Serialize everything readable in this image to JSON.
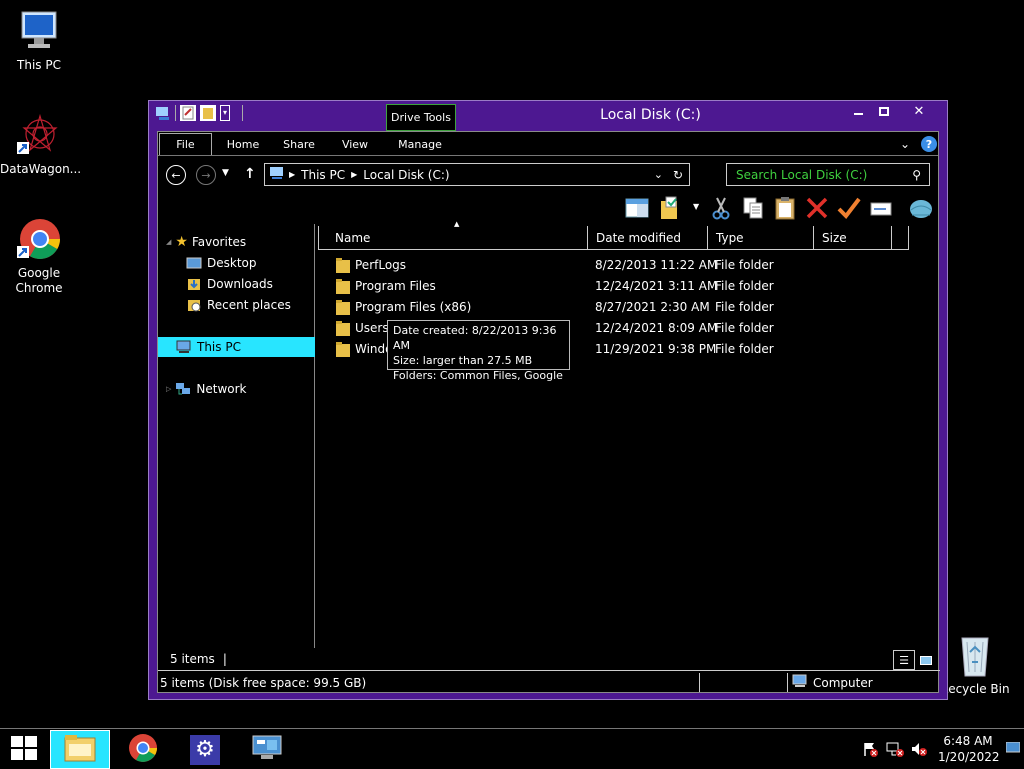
{
  "desktop": {
    "icons": [
      {
        "label": "This PC",
        "icon": "computer-icon"
      },
      {
        "label": "DataWagon...",
        "icon": "datawagon-icon"
      },
      {
        "label": "Google\nChrome",
        "icon": "chrome-icon"
      },
      {
        "label": "Recycle Bin",
        "icon": "recycle-bin-icon"
      }
    ]
  },
  "window": {
    "title": "Local Disk (C:)",
    "contextual_tab": "Drive Tools",
    "ribbon_tabs": [
      "File",
      "Home",
      "Share",
      "View",
      "Manage"
    ],
    "address": {
      "segments": [
        "This PC",
        "Local Disk (C:)"
      ]
    },
    "search_placeholder": "Search Local Disk (C:)",
    "nav": {
      "favorites": "Favorites",
      "desktop": "Desktop",
      "downloads": "Downloads",
      "recent": "Recent places",
      "thispc": "This PC",
      "network": "Network"
    },
    "columns": [
      "Name",
      "Date modified",
      "Type",
      "Size"
    ],
    "files": [
      {
        "name": "PerfLogs",
        "date": "8/22/2013 11:22 AM",
        "type": "File folder"
      },
      {
        "name": "Program Files",
        "date": "12/24/2021 3:11 AM",
        "type": "File folder"
      },
      {
        "name": "Program Files (x86)",
        "date": "8/27/2021 2:30 AM",
        "type": "File folder"
      },
      {
        "name": "Users",
        "date": "12/24/2021 8:09 AM",
        "type": "File folder"
      },
      {
        "name": "Windo",
        "date": "11/29/2021 9:38 PM",
        "type": "File folder"
      }
    ],
    "tooltip": {
      "line1": "Date created: 8/22/2013 9:36 AM",
      "line2": "Size: larger than 27.5 MB",
      "line3": "Folders: Common Files, Google"
    },
    "item_count": "5 items",
    "status_left": "5 items (Disk free space: 99.5 GB)",
    "status_right": "Computer"
  },
  "taskbar": {
    "time": "6:48 AM",
    "date": "1/20/2022"
  },
  "colors": {
    "window_frame": "#4d1891",
    "selection": "#28e5ff",
    "search_text": "#3fd03f"
  }
}
